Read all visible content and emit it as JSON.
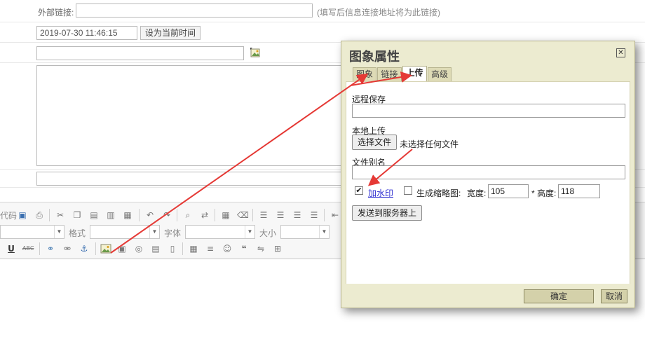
{
  "form": {
    "external_link_label": "外部链接:",
    "external_link_hint": "(填写后信息连接地址将为此链接)",
    "datetime_value": "2019-07-30 11:46:15",
    "set_now_button": "设为当前时间"
  },
  "toolbar": {
    "source_partial": "代码",
    "format_label": "格式",
    "font_label": "字体",
    "size_label": "大小"
  },
  "dialog": {
    "title": "图象属性",
    "close_glyph": "✕",
    "tabs": [
      "图象",
      "链接",
      "上传",
      "高级"
    ],
    "active_tab": "上传",
    "remote_save_label": "远程保存",
    "local_upload_label": "本地上传",
    "choose_file_button": "选择文件",
    "no_file_text": "未选择任何文件",
    "file_alias_label": "文件别名",
    "watermark_checked": "✔",
    "watermark_label": "加水印",
    "thumbnail_label": "生成缩略图:",
    "width_label": "宽度:",
    "width_value": "105",
    "height_label": "* 高度:",
    "height_value": "118",
    "send_to_server_button": "发送到服务器上",
    "ok_button": "确定",
    "cancel_button": "取消"
  },
  "colors": {
    "dialog_bg": "#ecebd0",
    "arrow": "#e53935"
  }
}
